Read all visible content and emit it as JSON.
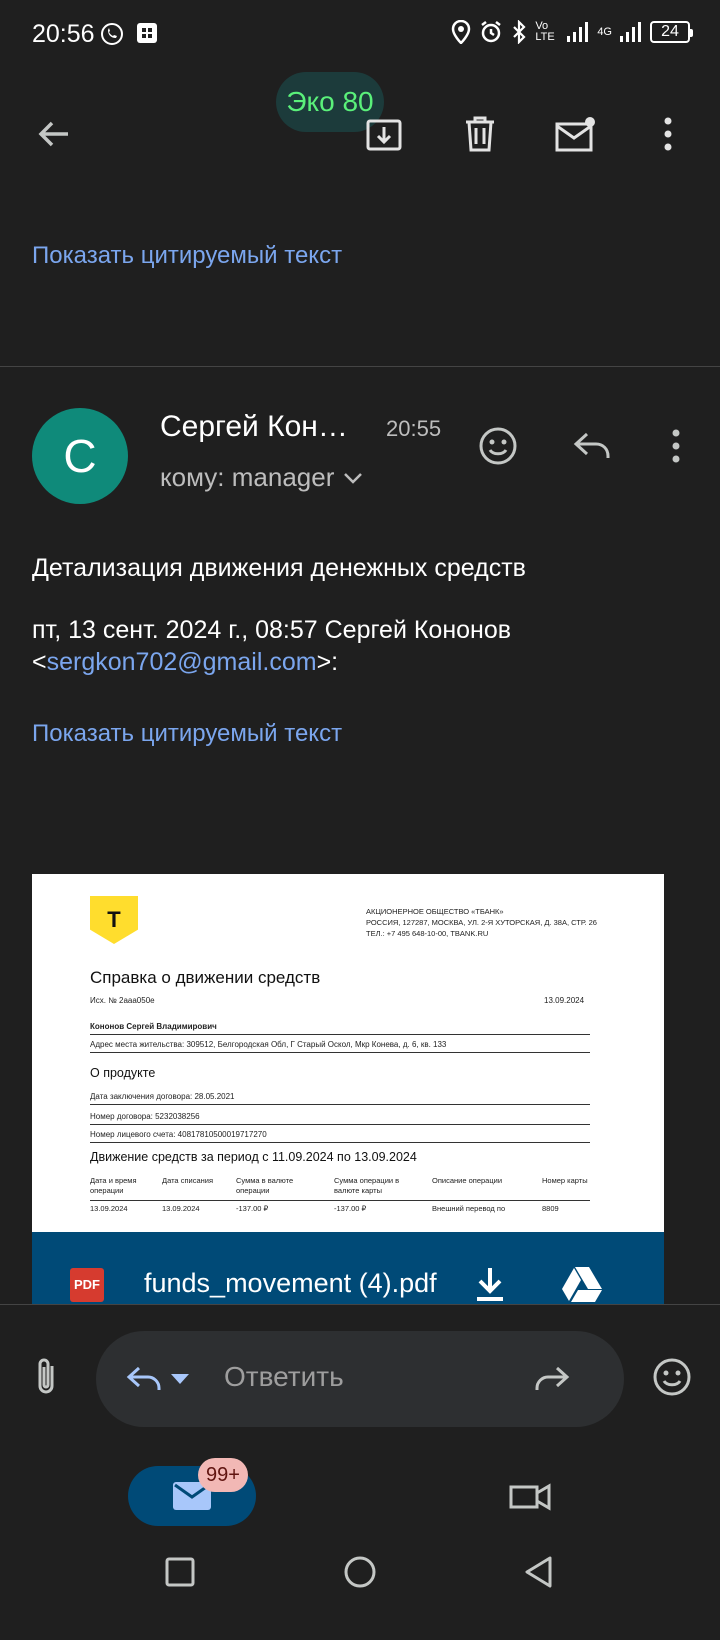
{
  "status_bar": {
    "time": "20:56",
    "battery": "24",
    "network_label": "Vo LTE",
    "network_4g": "4G"
  },
  "top_bar": {
    "eco_label": "Эко 80",
    "actions": [
      "back",
      "archive",
      "delete",
      "mark-unread",
      "more"
    ]
  },
  "thread": {
    "prev_show_quoted": "Показать цитируемый текст",
    "message": {
      "avatar_letter": "C",
      "sender": "Сергей Кон…",
      "time": "20:55",
      "to_line": "кому: manager",
      "subject_line": "Детализация движения денежных средств",
      "quote_header_1": "пт, 13 сент. 2024 г., 08:57 Сергей Кононов",
      "quote_open": "<",
      "quote_email": "sergkon702@gmail.com",
      "quote_close": ">:",
      "show_quoted": "Показать цитируемый текст"
    }
  },
  "attachment": {
    "doc": {
      "logo_letter": "T",
      "org_1": "АКЦИОНЕРНОЕ ОБЩЕСТВО «ТБАНК»",
      "org_2": "РОССИЯ, 127287, МОСКВА, УЛ. 2-Я ХУТОРСКАЯ, Д. 38А, СТР. 26",
      "org_3": "ТЕЛ.: +7 495 648-10-00, TBANK.RU",
      "title": "Справка о движении средств",
      "ref": "Исх. № 2ааа050е",
      "date": "13.09.2024",
      "client_name": "Кононов Сергей Владимирович",
      "address": "Адрес места жительства: 309512, Белгородская Обл, Г Старый Оскол, Мкр Конева, д. 6, кв. 133",
      "product_heading": "О продукте",
      "contract_date": "Дата заключения договора: 28.05.2021",
      "contract_number": "Номер договора: 5232038256",
      "account_number": "Номер лицевого счета: 40817810500019717270",
      "period_heading": "Движение средств за период с 11.09.2024 по 13.09.2024",
      "table_headers": [
        "Дата и время операции",
        "Дата списания",
        "Сумма в валюте операции",
        "Сумма операции в валюте карты",
        "Описание операции",
        "Номер карты"
      ],
      "row": [
        "13.09.2024",
        "13.09.2024",
        "-137.00 ₽",
        "-137.00 ₽",
        "Внешний перевод по",
        "8809"
      ]
    },
    "pdf_badge": "PDF",
    "file_name": "funds_movement (4).pdf"
  },
  "reply_bar": {
    "placeholder": "Ответить"
  },
  "bottom_nav": {
    "mail_badge": "99+"
  }
}
